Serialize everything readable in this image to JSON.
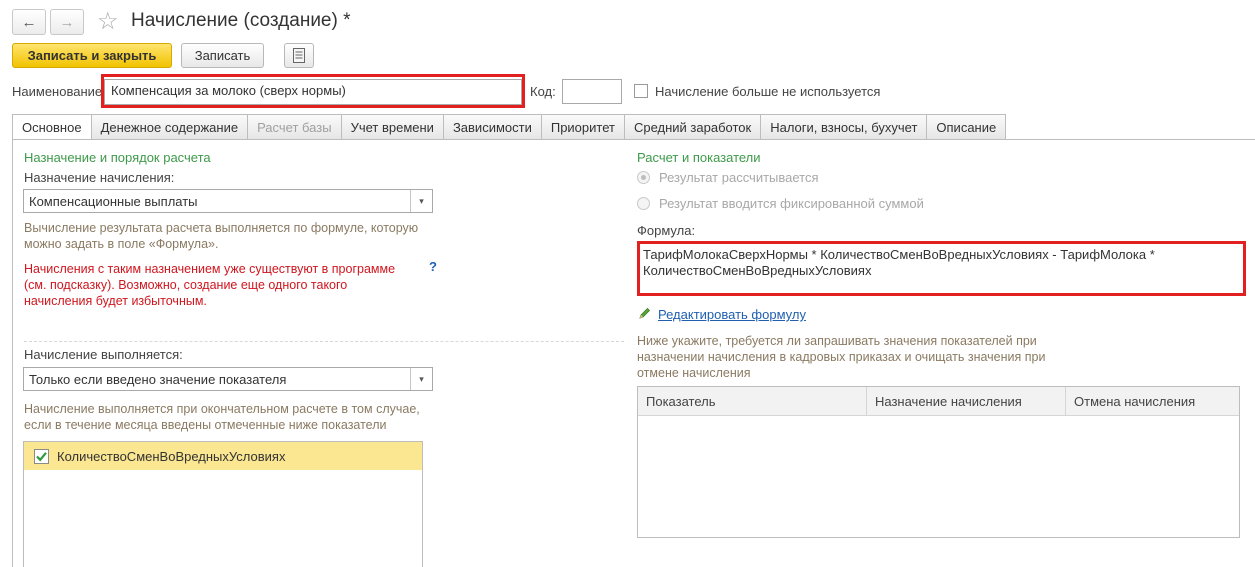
{
  "header": {
    "back_glyph": "←",
    "forward_glyph": "→",
    "star_glyph": "☆",
    "title": "Начисление (создание) *"
  },
  "toolbar": {
    "save_close_label": "Записать и закрыть",
    "save_label": "Записать"
  },
  "form": {
    "name_label": "Наименование:",
    "name_value": "Компенсация за молоко (сверх нормы)",
    "code_label": "Код:",
    "code_value": "",
    "not_used_label": "Начисление больше не используется"
  },
  "tabs": [
    {
      "label": "Основное"
    },
    {
      "label": "Денежное содержание"
    },
    {
      "label": "Расчет базы"
    },
    {
      "label": "Учет времени"
    },
    {
      "label": "Зависимости"
    },
    {
      "label": "Приоритет"
    },
    {
      "label": "Средний заработок"
    },
    {
      "label": "Налоги, взносы, бухучет"
    },
    {
      "label": "Описание"
    }
  ],
  "left": {
    "section_title": "Назначение и порядок расчета",
    "purpose_label": "Назначение начисления:",
    "purpose_value": "Компенсационные выплаты",
    "purpose_hint": "Вычисление результата расчета выполняется по формуле, которую можно задать в поле «Формула».",
    "warning": "Начисления с таким назначением уже существуют в программе (см. подсказку). Возможно, создание еще одного такого начисления будет избыточным.",
    "help_glyph": "?",
    "exec_label": "Начисление выполняется:",
    "exec_value": "Только если введено значение показателя",
    "exec_hint": "Начисление выполняется при окончательном расчете в том случае, если в течение месяца введены отмеченные ниже показатели",
    "indicators": [
      {
        "label": "КоличествоСменВоВредныхУсловиях",
        "checked": true
      }
    ]
  },
  "right": {
    "section_title": "Расчет и показатели",
    "radio_calculated": "Результат рассчитывается",
    "radio_fixed": "Результат вводится фиксированной суммой",
    "formula_label": "Формула:",
    "formula_value": "ТарифМолокаСверхНормы * КоличествоСменВоВредныхУсловиях - ТарифМолока * КоличествоСменВоВредныхУсловиях",
    "edit_formula_link": "Редактировать формулу",
    "indicators_hint": "Ниже укажите, требуется ли запрашивать значения показателей при назначении начисления в кадровых приказах и очищать значения при отмене начисления",
    "grid_columns": [
      "Показатель",
      "Назначение начисления",
      "Отмена начисления"
    ]
  },
  "colors": {
    "primary_button": "#f1c300",
    "highlight_border": "#e32020",
    "section_green": "#3e9a4a",
    "warning_red": "#d0161e",
    "selected_row": "#fbe792"
  }
}
